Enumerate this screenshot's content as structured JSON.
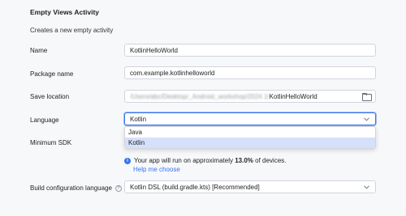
{
  "header": {
    "title": "Empty Views Activity",
    "subtitle": "Creates a new empty activity"
  },
  "form": {
    "name": {
      "label": "Name",
      "value": "KotlinHelloWorld"
    },
    "package": {
      "label": "Package name",
      "value": "com.example.kotlinhelloworld"
    },
    "save_location": {
      "label": "Save location",
      "value_blurred": "/Users/abc/Desktop/_Android_workshop/2024 1/",
      "value_suffix": "KotlinHelloWorld"
    },
    "language": {
      "label": "Language",
      "selected": "Kotlin",
      "options": [
        "Java",
        "Kotlin"
      ]
    },
    "min_sdk": {
      "label": "Minimum SDK",
      "info_prefix": "Your app will run on approximately ",
      "info_percent": "13.0%",
      "info_suffix": " of devices.",
      "help_link": "Help me choose"
    },
    "build_config": {
      "label": "Build configuration language",
      "value": "Kotlin DSL (build.gradle.kts) [Recommended]"
    }
  },
  "colors": {
    "accent": "#3574f0",
    "selection": "#d5e1fa",
    "background": "#f7f8fa"
  }
}
